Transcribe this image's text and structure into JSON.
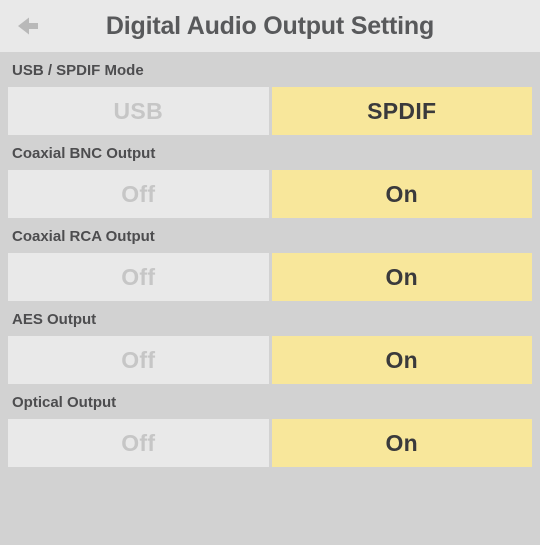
{
  "header": {
    "title": "Digital Audio Output Setting",
    "back_icon": "back-arrow-icon"
  },
  "colors": {
    "page_background": "#d2d2d2",
    "header_background": "#e9e9e9",
    "active_option": "#f8e79b",
    "inactive_option": "#e9e9e9",
    "active_text": "#3a3a3c",
    "inactive_text": "#c6c6c6",
    "label_text": "#4d4d4f"
  },
  "groups": [
    {
      "label": "USB / SPDIF Mode",
      "options": [
        {
          "label": "USB",
          "selected": false
        },
        {
          "label": "SPDIF",
          "selected": true
        }
      ]
    },
    {
      "label": "Coaxial BNC Output",
      "options": [
        {
          "label": "Off",
          "selected": false
        },
        {
          "label": "On",
          "selected": true
        }
      ]
    },
    {
      "label": "Coaxial RCA Output",
      "options": [
        {
          "label": "Off",
          "selected": false
        },
        {
          "label": "On",
          "selected": true
        }
      ]
    },
    {
      "label": "AES Output",
      "options": [
        {
          "label": "Off",
          "selected": false
        },
        {
          "label": "On",
          "selected": true
        }
      ]
    },
    {
      "label": "Optical Output",
      "options": [
        {
          "label": "Off",
          "selected": false
        },
        {
          "label": "On",
          "selected": true
        }
      ]
    }
  ]
}
